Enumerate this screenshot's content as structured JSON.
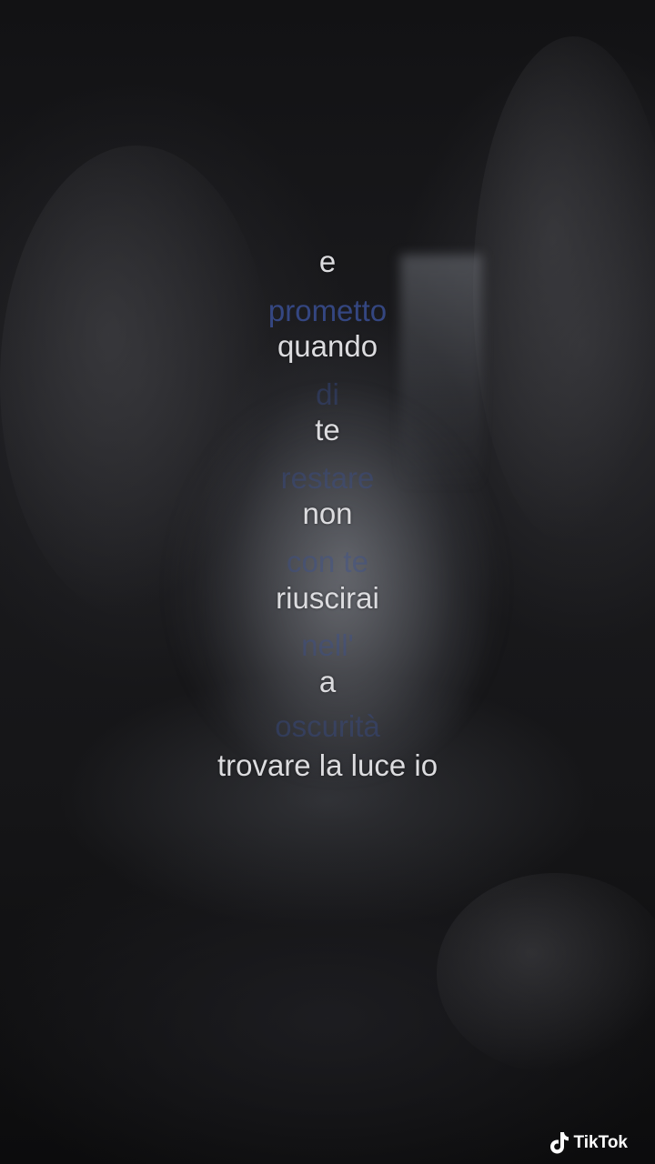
{
  "lyrics": {
    "line_e": "e",
    "line_prometto": "prometto",
    "line_quando": "quando",
    "line_di": "di",
    "line_te": "te",
    "line_restare": "restare",
    "line_non": "non",
    "line_con_te": "con te",
    "line_riuscirai": "riuscirai",
    "line_nell": "nell'",
    "line_a": "a",
    "line_oscurita": "oscurità",
    "line_trovare": "trovare la luce io"
  },
  "watermark": {
    "brand": "TikTok",
    "icon": "tiktok-logo-icon"
  },
  "colors": {
    "white_text": "#dcdcdf",
    "blue_text": "#3e58a8",
    "background": "#0b0b0c"
  }
}
